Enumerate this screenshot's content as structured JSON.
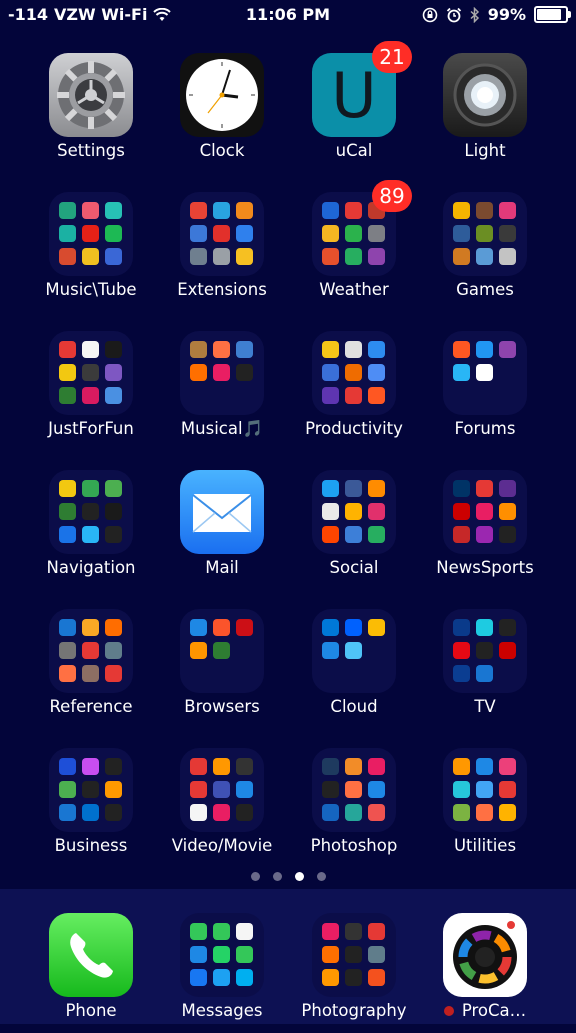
{
  "status_bar": {
    "signal": "-114",
    "carrier": "VZW Wi-Fi",
    "time": "11:06 PM",
    "battery": "99%",
    "battery_level": 0.99
  },
  "badges": {
    "ucal": "21",
    "weather": "89"
  },
  "apps": {
    "settings": "Settings",
    "clock": "Clock",
    "ucal": "uCal",
    "ucal_letter": "U",
    "light": "Light",
    "music_tube": "Music\\Tube",
    "extensions": "Extensions",
    "weather": "Weather",
    "games": "Games",
    "justforfun": "JustForFun",
    "musical": "Musical🎵",
    "productivity": "Productivity",
    "forums": "Forums",
    "navigation": "Navigation",
    "mail": "Mail",
    "social": "Social",
    "newssports": "NewsSports",
    "reference": "Reference",
    "browsers": "Browsers",
    "cloud": "Cloud",
    "tv": "TV",
    "business": "Business",
    "video_movie": "Video/Movie",
    "photoshop": "Photoshop",
    "utilities": "Utilities"
  },
  "dock": {
    "phone": "Phone",
    "messages": "Messages",
    "photography": "Photography",
    "procamera": "ProCa…"
  },
  "page_indicator": {
    "pages": 4,
    "current": 3
  },
  "colors": {
    "wallpaper": "#03053a",
    "dock": "#0d1153",
    "badge": "#ff2d26"
  },
  "folder_colors": {
    "music_tube": [
      "#22a37e",
      "#ef5a6f",
      "#27c1b5",
      "#1bb1a3",
      "#e62117",
      "#1db954",
      "#d84b2f",
      "#f0c020",
      "#3a67d6"
    ],
    "extensions": [
      "#e84335",
      "#29a3e0",
      "#f28a1c",
      "#3c78d8",
      "#e2302b",
      "#2f80ed",
      "#6f7f8f",
      "#9aa0a6",
      "#f6c022"
    ],
    "weather": [
      "#1e66d6",
      "#e53935",
      "#c0392b",
      "#f5b622",
      "#2bb24c",
      "#7d7f85",
      "#e6502c",
      "#27ae60",
      "#8e44ad"
    ],
    "games": [
      "#f4b400",
      "#7b4a2f",
      "#e23a7a",
      "#2e5c9a",
      "#6b8e23",
      "#3a3a3a",
      "#d17a22",
      "#5a9bd6",
      "#c3c3c3"
    ],
    "justforfun": [
      "#e53935",
      "#f5f5f5",
      "#1a1a1a",
      "#f2c811",
      "#3b3b3b",
      "#7e57c2",
      "#2e7d32",
      "#d81b60",
      "#4a90e2"
    ],
    "musical": [
      "#b07d3f",
      "#ff7043",
      "#3f7fd1",
      "#ff6f00",
      "#e91e63",
      "#222"
    ],
    "productivity": [
      "#f5c518",
      "#e0e0e0",
      "#2d8cf0",
      "#3a6fd8",
      "#ef6c00",
      "#4e8df5",
      "#5e35b1",
      "#e53935",
      "#ff5722"
    ],
    "forums": [
      "#ff5722",
      "#2196f3",
      "#8e44ad",
      "#29b6f6",
      "#ffffff"
    ],
    "navigation": [
      "#f2c811",
      "#34a853",
      "#4caf50",
      "#2e7d32",
      "#222222",
      "#1a1a1a",
      "#1a73e8",
      "#29b6f6",
      "#222222"
    ],
    "social": [
      "#1da1f2",
      "#3b5998",
      "#ff8c00",
      "#e9e9e9",
      "#ffb300",
      "#e1306c",
      "#ff4500",
      "#3d7fd8",
      "#27ae60"
    ],
    "newssports": [
      "#003366",
      "#e53935",
      "#5c2d91",
      "#cc0000",
      "#e91e63",
      "#ff8f00",
      "#c62828",
      "#9b27b0",
      "#222222"
    ],
    "reference": [
      "#1976d2",
      "#f9a825",
      "#ff6d00",
      "#757575",
      "#e53935",
      "#607d8b",
      "#ff7043",
      "#8d6e63",
      "#e53935"
    ],
    "browsers": [
      "#1e88e5",
      "#fb542b",
      "#cc0f16",
      "#ff9500",
      "#2e7d32"
    ],
    "cloud": [
      "#0078d7",
      "#0061fe",
      "#fbbc05",
      "#1e88e5",
      "#4fc3f7"
    ],
    "tv": [
      "#0a3a8a",
      "#1ecbe1",
      "#222222",
      "#e50914",
      "#222222",
      "#cc0000",
      "#0b3d91",
      "#1976d2"
    ],
    "business": [
      "#1e4fd8",
      "#c84ef0",
      "#222222",
      "#4caf50",
      "#222222",
      "#ff9900",
      "#1976d2",
      "#0071ce",
      "#222222"
    ],
    "video_movie": [
      "#e53935",
      "#ff9800",
      "#333333",
      "#e53935",
      "#3f51b5",
      "#1e88e5",
      "#f5f5f5",
      "#e91e63",
      "#222222"
    ],
    "photoshop": [
      "#1e3a5f",
      "#f28c28",
      "#e91e63",
      "#222222",
      "#ff7043",
      "#1e88e5",
      "#1565c0",
      "#26a69a",
      "#ef5350"
    ],
    "utilities": [
      "#ff9800",
      "#1e88e5",
      "#ec407a",
      "#26c6da",
      "#42a5f5",
      "#e53935",
      "#7cb342",
      "#ff7043",
      "#ffb300"
    ],
    "messages_dock": [
      "#34c759",
      "#34c759",
      "#f5f5f5",
      "#1e88e5",
      "#25d366",
      "#34c759",
      "#1877f2",
      "#1da1f2",
      "#00aff0"
    ],
    "photography_dock": [
      "#e91e63",
      "#333333",
      "#e53935",
      "#ff6f00",
      "#222222",
      "#607d8b",
      "#ff9800",
      "#222222",
      "#f4511e"
    ]
  }
}
